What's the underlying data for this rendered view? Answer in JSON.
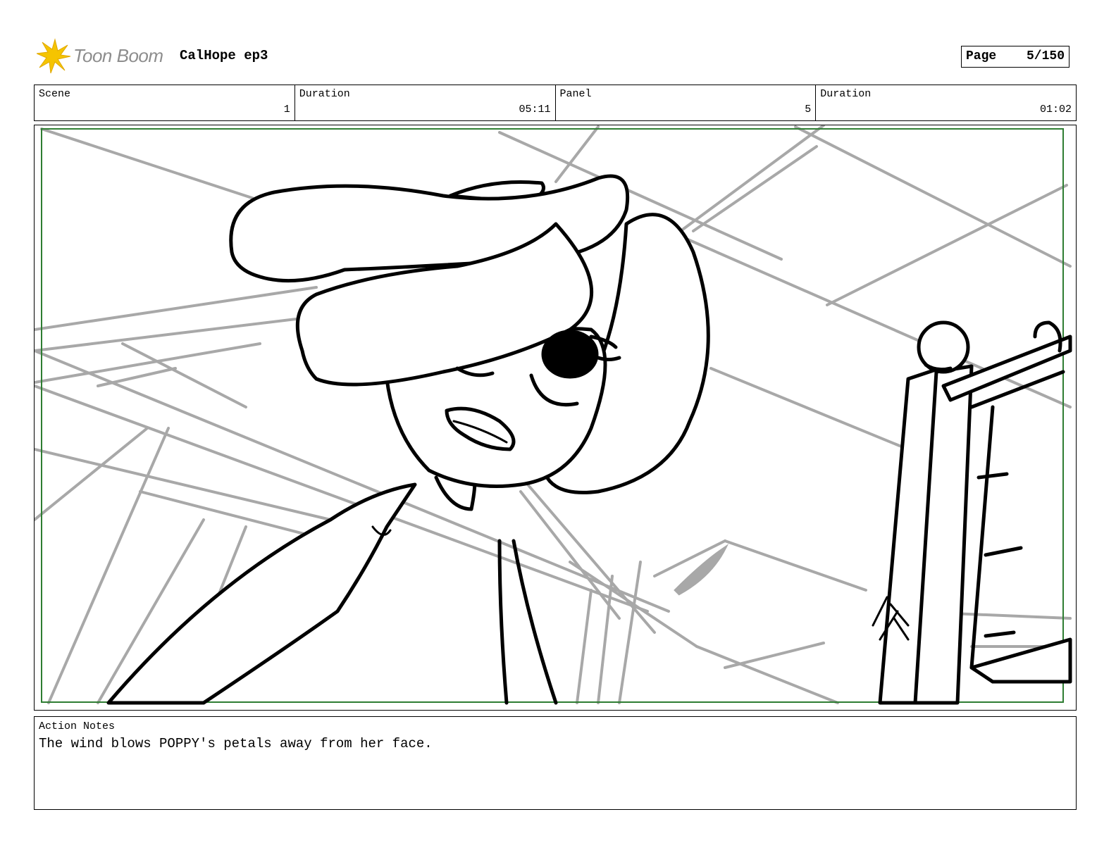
{
  "header": {
    "logo_text": "Toon Boom",
    "project_title": "CalHope ep3",
    "page_label": "Page",
    "page_value": "5/150"
  },
  "info": {
    "scene_label": "Scene",
    "scene_value": "1",
    "scene_duration_label": "Duration",
    "scene_duration_value": "05:11",
    "panel_label": "Panel",
    "panel_value": "5",
    "panel_duration_label": "Duration",
    "panel_duration_value": "01:02"
  },
  "notes": {
    "label": "Action Notes",
    "text": "The wind blows POPPY's petals away from her face."
  },
  "colors": {
    "safe_frame": "#2e7d32",
    "logo_star": "#f5c400",
    "sketch_gray": "#a8a8a8"
  }
}
